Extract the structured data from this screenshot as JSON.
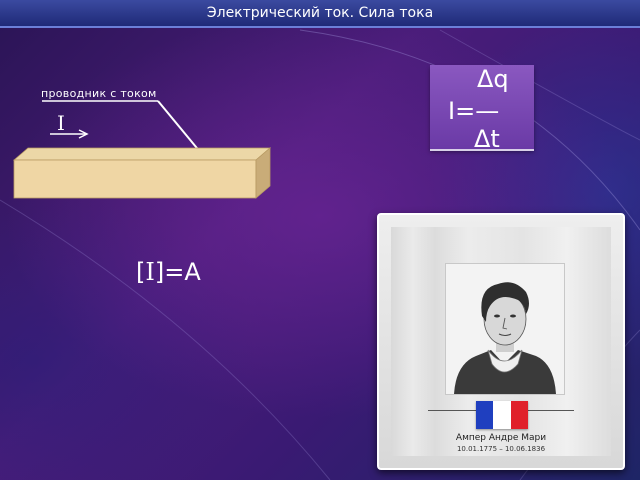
{
  "slide": {
    "title": "Электрический ток. Сила тока",
    "conductor_label": "проводник с током",
    "current_symbol": "I",
    "formula": {
      "numerator": "Δq",
      "lhs": "I=—",
      "denominator": "Δt"
    },
    "unit": {
      "open": "[",
      "symbol": "I",
      "close": "]=А"
    },
    "portrait": {
      "name": "Ампер Андре Мари",
      "dates": "10.01.1775 – 10.06.1836",
      "flag_colors": [
        "#1f3fbf",
        "#ffffff",
        "#e0202a"
      ]
    }
  }
}
